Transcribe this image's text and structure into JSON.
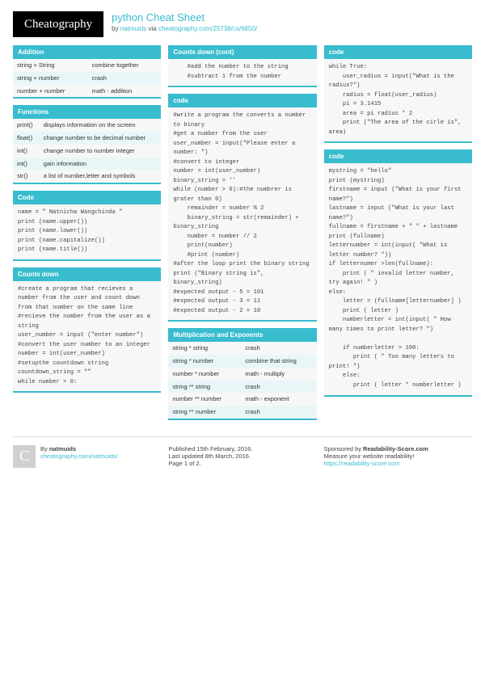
{
  "logo": "Cheatography",
  "title": "python Cheat Sheet",
  "byline_pre": "by ",
  "author": "natmuids",
  "byline_via": " via ",
  "url": "cheatography.com/25738/cs/6850/",
  "col1": [
    {
      "head": "Addition",
      "type": "tbl",
      "rows": [
        [
          "string + String",
          "combine together"
        ],
        [
          "string + number",
          "crash"
        ],
        [
          "number + number",
          "math - addition"
        ]
      ]
    },
    {
      "head": "Functions",
      "type": "tbl",
      "rows": [
        [
          "print()",
          "displays information on the screen"
        ],
        [
          "float()",
          "change number to be decimal number"
        ],
        [
          "int()",
          "change number to number integer"
        ],
        [
          "int()",
          "gain information"
        ],
        [
          "str()",
          "a list of number,letter and symbols"
        ]
      ]
    },
    {
      "head": "Code",
      "type": "code",
      "body": "name = \" Natnicha Wangchinda \"\nprint (name.upper())\nprint (name.lower())\nprint (name.capitalize())\nprint (name.title())"
    },
    {
      "head": "Counts down",
      "type": "code",
      "body": "#create a program that recieves a number from the user and count down from that number on the same line\n#recieve the number from the user as a string\nuser_number = input (\"enter number\")\n#convert the user number to an integer\nnumber = int(user_number)\n#setupthe countdown string\ncountdown_string = \"\"\nwhile number > 0:"
    }
  ],
  "col2": [
    {
      "head": "Counts down (cont)",
      "type": "code",
      "body": "    #add the number to the string\n    #subtract 1 from the number"
    },
    {
      "head": "code",
      "type": "code",
      "body": "#write a program the converts a number to binary\n#get a number from the user\nuser_number = input(\"Please enter a number: \")\n#convert to integer\nnumber = int(user_number)\nbinary_string = ''\nwhile (number > 0):#the numbrer is grater than 0)\n    remainder = number % 2\n    binary_string = str(remainder) + binary_string\n    number = number // 2\n    print(number)\n    #print (number)\n#after the loop print the binary string\nprint (\"Binary string is\", binary_string)\n#expected output - 5 = 101\n#expected output - 3 = 11\n#expected output - 2 = 10"
    },
    {
      "head": "Multiplication and Exponents",
      "type": "tbl",
      "rows": [
        [
          "string * string",
          "crash"
        ],
        [
          "string * number",
          "combine that string"
        ],
        [
          "number * number",
          "math - multiply"
        ],
        [
          "string ** string",
          "crash"
        ],
        [
          "number ** number",
          "math - exponent"
        ],
        [
          "string ** number",
          "crash"
        ]
      ]
    }
  ],
  "col3": [
    {
      "head": "code",
      "type": "code",
      "body": "while True:\n    user_radius = input(\"What is the radius?\")\n    radius = float(user_radius)\n    pi = 3.1415\n    area = pi radius * 2\n    print (\"The area of the cirle is\", area)"
    },
    {
      "head": "code",
      "type": "code",
      "body": "mystring = \"hello\"\nprint (mystring)\nfirstname = input (\"What is your first name?\")\nlastname = input (\"What is your last name?\")\nfullname = firstname + \" \" + lastname\nprint (fullname)\nletternumber = int(input( \"What is letter number? \"))\nif letternumer >len(fullname):\n    print ( \" invalid letter number, try again! \" )\nelse:\n    letter = (fullname[letternumber] )\n    print ( letter )\n    numberletter = int(input( \" How many times to print letter? \")\n\n    if numberletter > 100:\n       print ( \" Too many letters to print! \")\n    else:\n       print ( letter * numberletter )"
    }
  ],
  "footer": {
    "c1_by": "By ",
    "c1_author": "natmuids",
    "c1_link": "cheatography.com/natmuids/",
    "c2_l1": "Published 15th February, 2016.",
    "c2_l2": "Last updated 8th March, 2016.",
    "c2_l3": "Page 1 of 2.",
    "c3_l1a": "Sponsored by ",
    "c3_l1b": "Readability-Score.com",
    "c3_l2": "Measure your website readability!",
    "c3_link": "https://readability-score.com"
  }
}
